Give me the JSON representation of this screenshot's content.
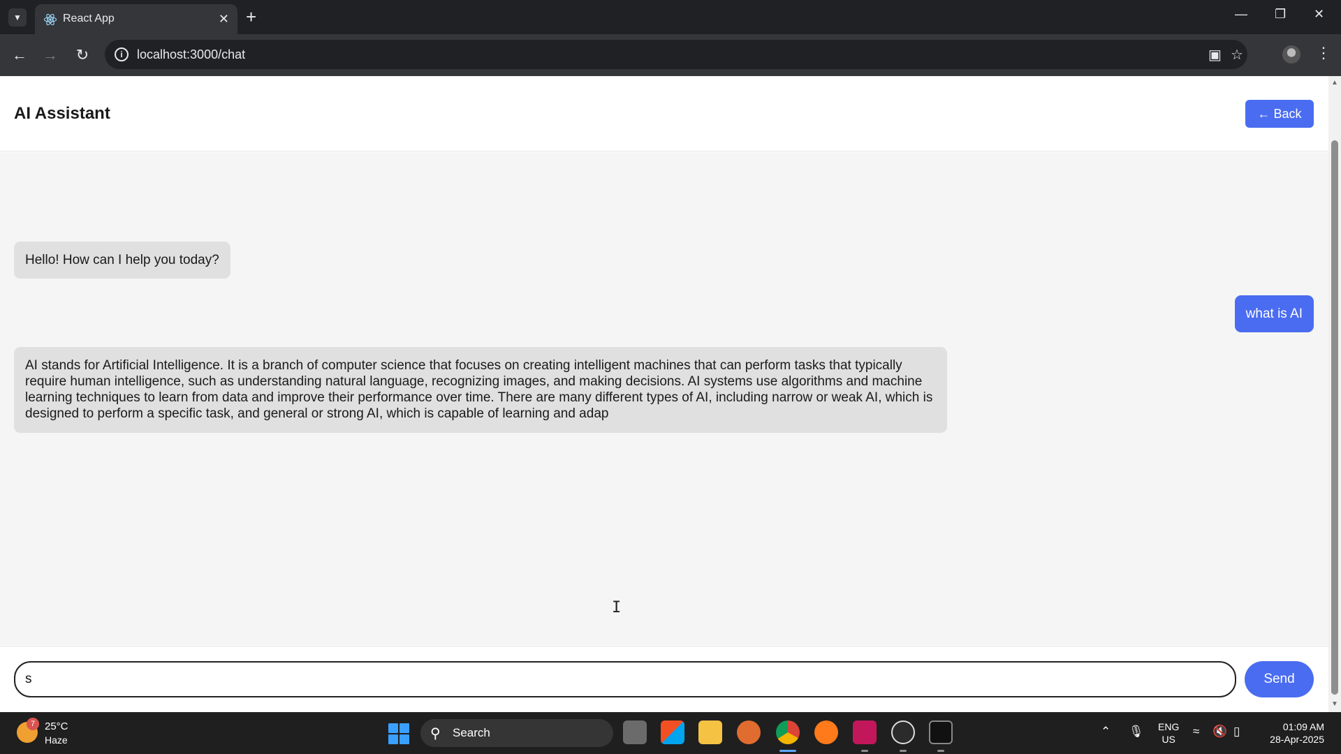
{
  "browser": {
    "tab_title": "React App",
    "url": "localhost:3000/chat",
    "icons": [
      "react-icon",
      "back-arrow-icon",
      "forward-arrow-icon",
      "reload-icon",
      "info-icon",
      "install-icon",
      "star-icon",
      "avatar",
      "menu-dots-icon"
    ]
  },
  "app": {
    "title": "AI Assistant",
    "back_label": "← Back",
    "accent_color": "#4a6cf0"
  },
  "messages": [
    {
      "role": "bot",
      "text": "Hello! How can I help you today?"
    },
    {
      "role": "user",
      "text": "what is AI"
    },
    {
      "role": "bot",
      "text": "AI stands for Artificial Intelligence. It is a branch of computer science that focuses on creating intelligent machines that can perform tasks that typically require human intelligence, such as understanding natural language, recognizing images, and making decisions. AI systems use algorithms and machine learning techniques to learn from data and improve their performance over time. There are many different types of AI, including narrow or weak AI, which is designed to perform a specific task, and general or strong AI, which is capable of learning and adap"
    }
  ],
  "composer": {
    "input_value": "s",
    "send_label": "Send"
  },
  "taskbar": {
    "weather_badge": "7",
    "weather_temp": "25°C",
    "weather_condition": "Haze",
    "search_label": "Search",
    "lang_line1": "ENG",
    "lang_line2": "US",
    "time": "01:09 AM",
    "date": "28-Apr-2025"
  }
}
